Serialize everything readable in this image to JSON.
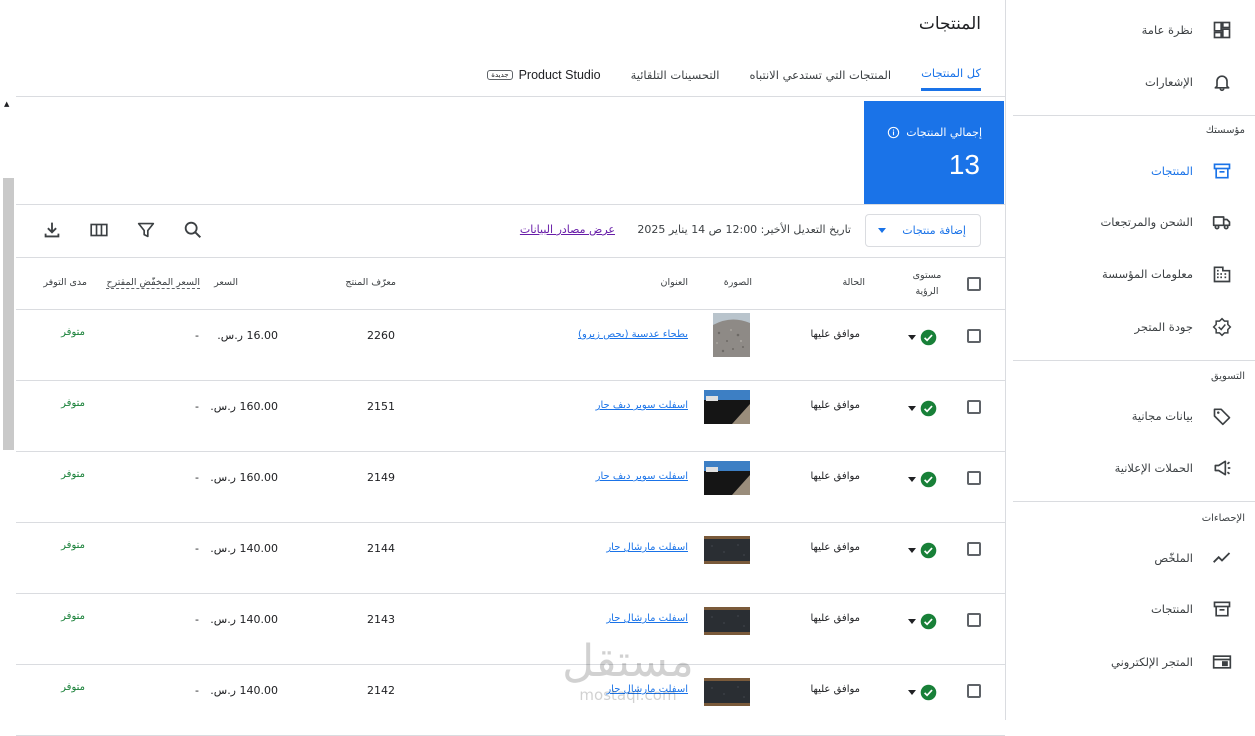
{
  "sidebar": {
    "top_items": [
      {
        "label": "نظرة عامة",
        "icon": "dashboard-icon"
      },
      {
        "label": "الإشعارات",
        "icon": "bell-icon"
      }
    ],
    "sections": [
      {
        "title": "مؤسستك",
        "items": [
          {
            "label": "المنتجات",
            "icon": "box-icon",
            "active": true
          },
          {
            "label": "الشحن والمرتجعات",
            "icon": "truck-icon"
          },
          {
            "label": "معلومات المؤسسة",
            "icon": "building-icon"
          },
          {
            "label": "جودة المتجر",
            "icon": "quality-badge-icon"
          }
        ]
      },
      {
        "title": "التسويق",
        "items": [
          {
            "label": "بيانات مجانية",
            "icon": "tag-icon"
          },
          {
            "label": "الحملات الإعلانية",
            "icon": "megaphone-icon"
          }
        ]
      },
      {
        "title": "الإحصاءات",
        "items": [
          {
            "label": "الملخّص",
            "icon": "trend-icon"
          },
          {
            "label": "المنتجات",
            "icon": "archive-icon"
          },
          {
            "label": "المتجر الإلكتروني",
            "icon": "storefront-icon"
          }
        ]
      }
    ]
  },
  "page": {
    "title": "المنتجات",
    "tabs": [
      {
        "label": "كل المنتجات",
        "active": true
      },
      {
        "label": "المنتجات التي تستدعي الانتباه"
      },
      {
        "label": "التحسينات التلقائية"
      },
      {
        "label": "Product Studio",
        "badge": "جديدة"
      }
    ]
  },
  "summary": {
    "label": "إجمالي المنتجات",
    "count": "13"
  },
  "toolbar": {
    "add_label": "إضافة منتجات",
    "last_modified": "تاريخ التعديل الأخير: 12:00 ص 14 يناير 2025",
    "sources_link": "عرض مصادر البيانات"
  },
  "table": {
    "headers": {
      "visibility": "مستوى الرؤية",
      "status": "الحالة",
      "image": "الصورة",
      "title": "العنوان",
      "id": "معرّف المنتج",
      "price": "السعر",
      "sale_price": "السعر المخفّض المقترح",
      "availability": "مدى التوفر"
    },
    "rows": [
      {
        "status": "موافق عليها",
        "title": "بطحاء عدسية (بحص زيرو)",
        "id": "2260",
        "price": "16.00 ر.س.",
        "sale": "-",
        "avail": "متوفر",
        "img": "gravel"
      },
      {
        "status": "موافق عليها",
        "title": "اسفلت سوبر ديف جار",
        "id": "2151",
        "price": "160.00 ر.س.",
        "sale": "-",
        "avail": "متوفر",
        "img": "road"
      },
      {
        "status": "موافق عليها",
        "title": "اسفلت سوبر ديف حار",
        "id": "2149",
        "price": "160.00 ر.س.",
        "sale": "-",
        "avail": "متوفر",
        "img": "road"
      },
      {
        "status": "موافق عليها",
        "title": "اسفلت مارشال حار",
        "id": "2144",
        "price": "140.00 ر.س.",
        "sale": "-",
        "avail": "متوفر",
        "img": "asphalt"
      },
      {
        "status": "موافق عليها",
        "title": "اسفلت مارشال حار",
        "id": "2143",
        "price": "140.00 ر.س.",
        "sale": "-",
        "avail": "متوفر",
        "img": "asphalt"
      },
      {
        "status": "موافق عليها",
        "title": "اسفلت مارشال حار",
        "id": "2142",
        "price": "140.00 ر.س.",
        "sale": "-",
        "avail": "متوفر",
        "img": "asphalt"
      }
    ]
  },
  "watermark": {
    "text": "مستقل",
    "sub": "mostaql.com"
  }
}
